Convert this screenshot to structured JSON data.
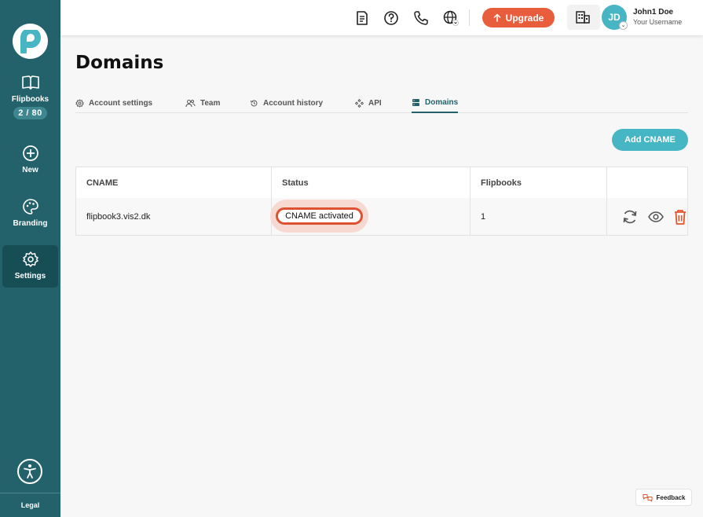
{
  "sidebar": {
    "items": [
      {
        "label": "Flipbooks",
        "badge": "2 / 80",
        "icon": "open-book-icon"
      },
      {
        "label": "New",
        "icon": "plus-circle-icon"
      },
      {
        "label": "Branding",
        "icon": "palette-icon"
      },
      {
        "label": "Settings",
        "icon": "gear-icon",
        "active": true
      }
    ],
    "legal": "Legal"
  },
  "topbar": {
    "upgrade_label": "Upgrade",
    "avatar_initials": "JD",
    "user_name": "John1 Doe",
    "user_subtitle": "Your Username"
  },
  "page": {
    "title": "Domains",
    "tabs": [
      {
        "label": "Account settings"
      },
      {
        "label": "Team"
      },
      {
        "label": "Account history"
      },
      {
        "label": "API"
      },
      {
        "label": "Domains",
        "active": true
      }
    ],
    "add_button": "Add CNAME"
  },
  "table": {
    "headers": [
      "CNAME",
      "Status",
      "Flipbooks"
    ],
    "rows": [
      {
        "cname": "flipbook3.vis2.dk",
        "status": "CNAME activated",
        "flipbooks": "1"
      }
    ]
  },
  "feedback_label": "Feedback",
  "colors": {
    "sidebar": "#23626a",
    "accent_orange": "#e85d3c",
    "accent_teal": "#46b6c4",
    "status_border": "#dd5230"
  }
}
